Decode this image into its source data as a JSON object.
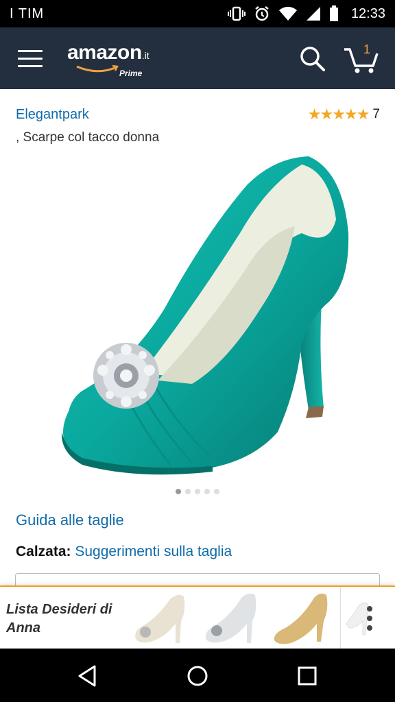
{
  "status_bar": {
    "carrier": "I TIM",
    "time": "12:33",
    "icons": [
      "vibrate-icon",
      "alarm-icon",
      "wifi-icon",
      "signal-icon",
      "battery-icon"
    ]
  },
  "header": {
    "logo_word": "amazon",
    "logo_tld": ".it",
    "logo_prime": "Prime",
    "cart_count": "1",
    "background": "#232f3e",
    "accent": "#f0a040"
  },
  "product": {
    "brand": "Elegantpark",
    "rating_stars": "★★★★★",
    "rating_count": "7",
    "subtitle": ", Scarpe col tacco donna",
    "image_count": 5,
    "active_image": 1,
    "colors": {
      "satin": "#0aa89e",
      "link": "#0e6ba8",
      "star": "#f5a623"
    }
  },
  "sizes": {
    "guide_link": "Guida alle taglie",
    "fit_label": "Calzata:",
    "fit_link": "Suggerimenti sulla taglia"
  },
  "wishlist": {
    "title": "Lista Desideri di Anna"
  }
}
